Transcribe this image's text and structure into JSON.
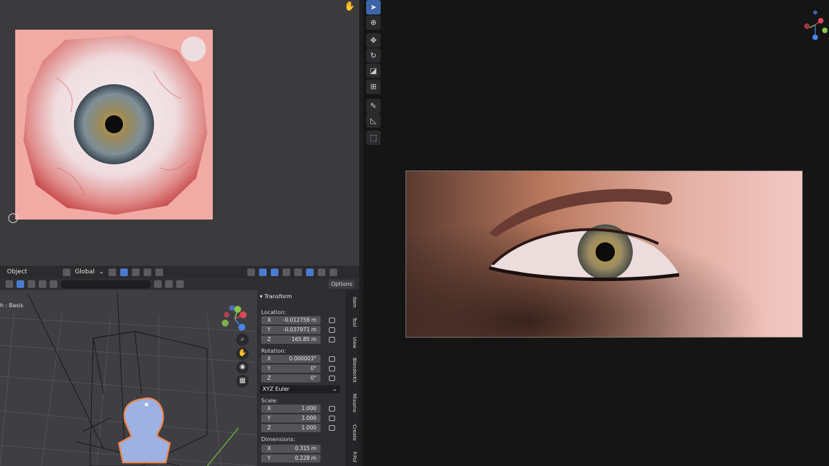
{
  "uv_editor": {
    "hand_icon": "hand-icon"
  },
  "viewport": {
    "header": {
      "object_menu": "Object",
      "transform_orientation": "Global",
      "options_label": "Options"
    },
    "mode_label": "h : Basis"
  },
  "npanel": {
    "title": "Transform",
    "location_label": "Location:",
    "location": [
      {
        "axis": "X",
        "value": "-0.012758 m"
      },
      {
        "axis": "Y",
        "value": "-0.037971 m"
      },
      {
        "axis": "Z",
        "value": "165.85 m"
      }
    ],
    "rotation_label": "Rotation:",
    "rotation": [
      {
        "axis": "X",
        "value": "0.000003°"
      },
      {
        "axis": "Y",
        "value": "0°"
      },
      {
        "axis": "Z",
        "value": "0°"
      }
    ],
    "rotation_mode": "XYZ Euler",
    "scale_label": "Scale:",
    "scale": [
      {
        "axis": "X",
        "value": "1.000"
      },
      {
        "axis": "Y",
        "value": "1.000"
      },
      {
        "axis": "Z",
        "value": "1.000"
      }
    ],
    "dimensions_label": "Dimensions:",
    "dimensions": [
      {
        "axis": "X",
        "value": "0.315 m"
      },
      {
        "axis": "Y",
        "value": "0.228 m"
      }
    ],
    "tabs": [
      "Item",
      "Tool",
      "View",
      "BlenderKit",
      "Mixamo",
      "Create",
      "P.Pol"
    ]
  },
  "toolbar": {
    "tools": [
      "select-icon",
      "cursor-icon",
      "move-icon",
      "rotate-icon",
      "scale-icon",
      "transform-icon",
      "annotate-icon",
      "measure-icon",
      "add-cube-icon"
    ]
  },
  "colors": {
    "accent": "#3e64a8",
    "gizmo_x": "#e0465a",
    "gizmo_y": "#8bc34a",
    "gizmo_z": "#4a86e8"
  }
}
